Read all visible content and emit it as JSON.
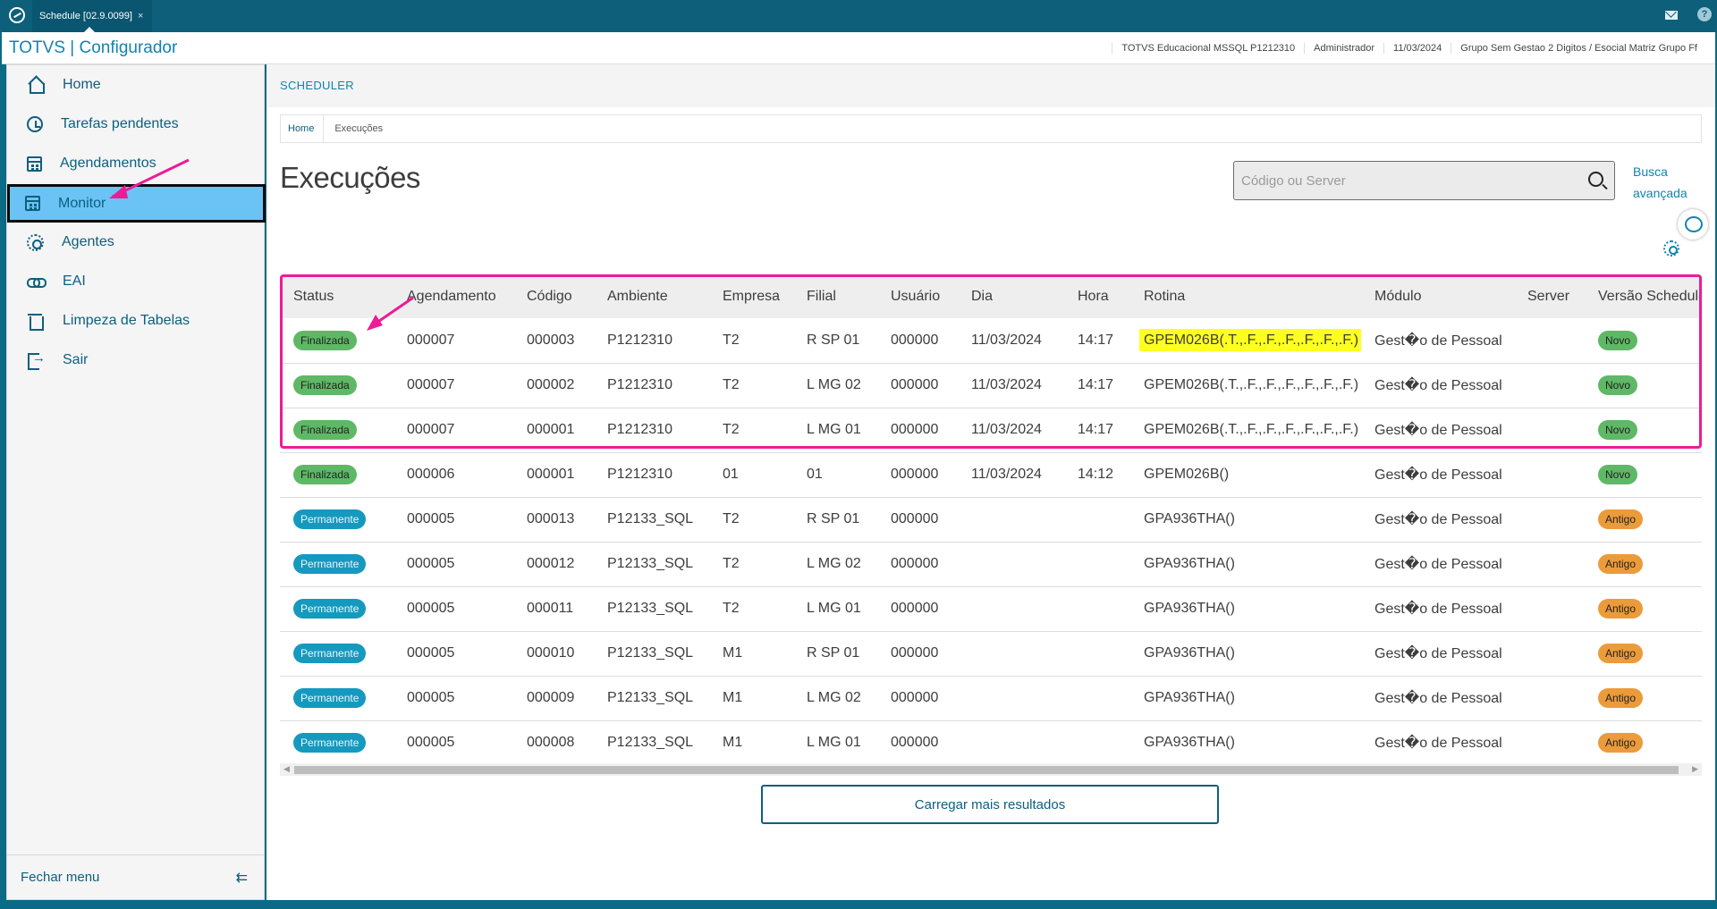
{
  "window": {
    "tab_title": "Schedule [02.9.0099]",
    "tab_close": "×",
    "help": "?"
  },
  "header": {
    "brand": "TOTVS | Configurador",
    "info": [
      "TOTVS Educacional MSSQL P1212310",
      "Administrador",
      "11/03/2024",
      "Grupo Sem Gestao 2 Digitos / Esocial Matriz Grupo Ff"
    ]
  },
  "sidebar": {
    "items": [
      {
        "label": "Home",
        "icon": "home-icon"
      },
      {
        "label": "Tarefas pendentes",
        "icon": "clock-history-icon"
      },
      {
        "label": "Agendamentos",
        "icon": "calendar-gear-icon"
      },
      {
        "label": "Monitor",
        "icon": "calendar-icon",
        "active": true
      },
      {
        "label": "Agentes",
        "icon": "gear-icon"
      },
      {
        "label": "EAI",
        "icon": "link-icon"
      },
      {
        "label": "Limpeza de Tabelas",
        "icon": "trash-icon"
      },
      {
        "label": "Sair",
        "icon": "exit-icon"
      }
    ],
    "footer_label": "Fechar menu"
  },
  "main": {
    "section_label": "SCHEDULER",
    "breadcrumb": [
      "Home",
      "Execuções"
    ],
    "title": "Execuções",
    "search_placeholder": "Código ou Server",
    "advanced_search": "Busca avançada",
    "load_more": "Carregar mais resultados"
  },
  "table": {
    "columns": [
      "Status",
      "Agendamento",
      "Código",
      "Ambiente",
      "Empresa",
      "Filial",
      "Usuário",
      "Dia",
      "Hora",
      "Rotina",
      "Módulo",
      "Server",
      "Versão Scheduler"
    ],
    "rows": [
      [
        "Finalizada",
        "000007",
        "000003",
        "P1212310",
        "T2",
        "R SP 01",
        "000000",
        "11/03/2024",
        "14:17",
        "GPEM026B(.T.,.F.,.F.,.F.,.F.,.F.,.F.)",
        "Gest�o de Pessoal",
        "",
        "Novo"
      ],
      [
        "Finalizada",
        "000007",
        "000002",
        "P1212310",
        "T2",
        "L MG 02",
        "000000",
        "11/03/2024",
        "14:17",
        "GPEM026B(.T.,.F.,.F.,.F.,.F.,.F.,.F.)",
        "Gest�o de Pessoal",
        "",
        "Novo"
      ],
      [
        "Finalizada",
        "000007",
        "000001",
        "P1212310",
        "T2",
        "L MG 01",
        "000000",
        "11/03/2024",
        "14:17",
        "GPEM026B(.T.,.F.,.F.,.F.,.F.,.F.,.F.)",
        "Gest�o de Pessoal",
        "",
        "Novo"
      ],
      [
        "Finalizada",
        "000006",
        "000001",
        "P1212310",
        "01",
        "01",
        "000000",
        "11/03/2024",
        "14:12",
        "GPEM026B()",
        "Gest�o de Pessoal",
        "",
        "Novo"
      ],
      [
        "Permanente",
        "000005",
        "000013",
        "P12133_SQL",
        "T2",
        "R SP 01",
        "000000",
        "",
        "",
        "GPA936THA()",
        "Gest�o de Pessoal",
        "",
        "Antigo"
      ],
      [
        "Permanente",
        "000005",
        "000012",
        "P12133_SQL",
        "T2",
        "L MG 02",
        "000000",
        "",
        "",
        "GPA936THA()",
        "Gest�o de Pessoal",
        "",
        "Antigo"
      ],
      [
        "Permanente",
        "000005",
        "000011",
        "P12133_SQL",
        "T2",
        "L MG 01",
        "000000",
        "",
        "",
        "GPA936THA()",
        "Gest�o de Pessoal",
        "",
        "Antigo"
      ],
      [
        "Permanente",
        "000005",
        "000010",
        "P12133_SQL",
        "M1",
        "R SP 01",
        "000000",
        "",
        "",
        "GPA936THA()",
        "Gest�o de Pessoal",
        "",
        "Antigo"
      ],
      [
        "Permanente",
        "000005",
        "000009",
        "P12133_SQL",
        "M1",
        "L MG 02",
        "000000",
        "",
        "",
        "GPA936THA()",
        "Gest�o de Pessoal",
        "",
        "Antigo"
      ],
      [
        "Permanente",
        "000005",
        "000008",
        "P12133_SQL",
        "M1",
        "L MG 01",
        "000000",
        "",
        "",
        "GPA936THA()",
        "Gest�o de Pessoal",
        "",
        "Antigo"
      ]
    ]
  },
  "colors": {
    "brand": "#1283b0",
    "finalizada": "#5fb865",
    "permanente": "#1699be",
    "antigo": "#ec9b3b",
    "highlight": "#ffff22",
    "annotation": "#ee1b95",
    "active_nav": "#6bc3f5"
  }
}
